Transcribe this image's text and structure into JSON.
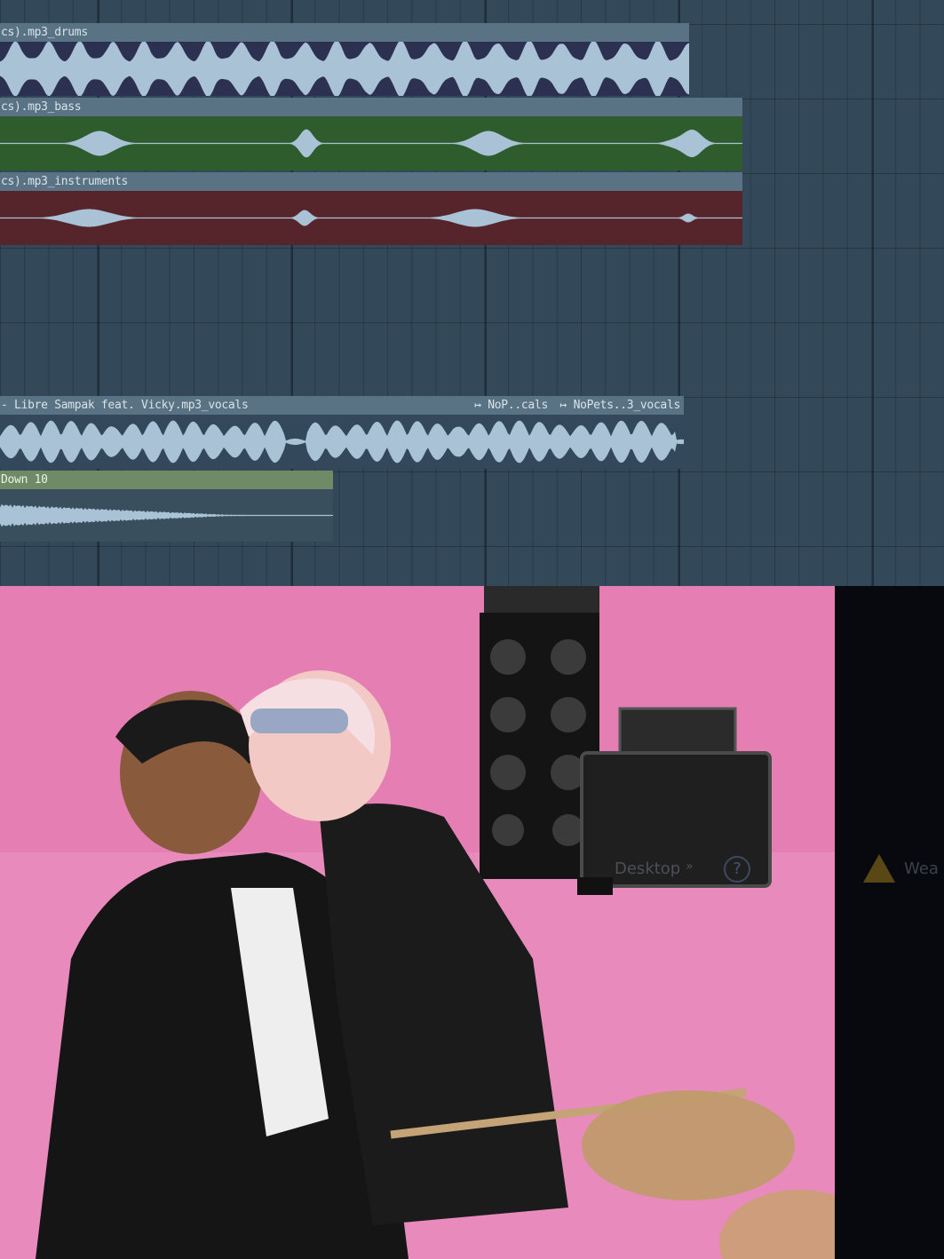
{
  "playlist": {
    "clips": [
      {
        "id": "drums",
        "label": "cs).mp3_drums"
      },
      {
        "id": "bass",
        "label": "cs).mp3_bass"
      },
      {
        "id": "instruments",
        "label": "cs).mp3_instruments"
      },
      {
        "id": "vocals",
        "label": "- Libre Sampak feat. Vicky.mp3_vocals",
        "slices": [
          "↦ NoP..cals",
          "↦ NoPets..3_vocals"
        ]
      },
      {
        "id": "down",
        "label": "Down 10"
      }
    ]
  },
  "overlay": {
    "taskbar_label": "Desktop",
    "taskbar_chevron": "»",
    "help_glyph": "?",
    "right_label": "Wea"
  },
  "colors": {
    "playlist_bg": "#33495a",
    "drums_clip": "#2c3152",
    "bass_clip": "#2e5c2c",
    "instruments_clip": "#56252b",
    "waveform": "#a9c2d6",
    "video_bg": "#e57fb3"
  },
  "icons": [
    "warning-icon",
    "help-icon",
    "chevron-right-icon"
  ]
}
